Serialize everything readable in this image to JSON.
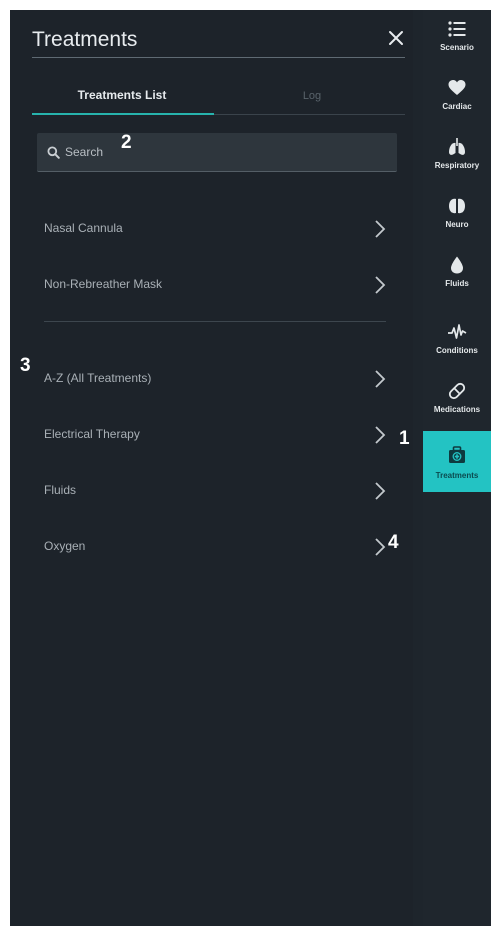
{
  "panel": {
    "title": "Treatments",
    "tabs": [
      {
        "label": "Treatments List",
        "active": true
      },
      {
        "label": "Log",
        "active": false
      }
    ],
    "search": {
      "placeholder": "Search",
      "value": ""
    },
    "recent_items": [
      "Nasal Cannula",
      "Non-Rebreather Mask"
    ],
    "category_items": [
      "A-Z (All Treatments)",
      "Electrical Therapy",
      "Fluids",
      "Oxygen"
    ]
  },
  "rail": {
    "items": [
      {
        "label": "Scenario",
        "icon": "list-icon"
      },
      {
        "label": "Cardiac",
        "icon": "heart-icon"
      },
      {
        "label": "Respiratory",
        "icon": "lungs-icon"
      },
      {
        "label": "Neuro",
        "icon": "brain-icon"
      },
      {
        "label": "Fluids",
        "icon": "droplet-icon"
      },
      {
        "label": "Conditions",
        "icon": "pulse-icon"
      },
      {
        "label": "Medications",
        "icon": "pill-icon"
      },
      {
        "label": "Treatments",
        "icon": "medkit-icon",
        "active": true
      }
    ]
  },
  "markers": [
    "1",
    "2",
    "3",
    "4"
  ],
  "colors": {
    "accent": "#23c3c3",
    "panel_bg": "#1d232a",
    "text": "#a9b0b6"
  }
}
